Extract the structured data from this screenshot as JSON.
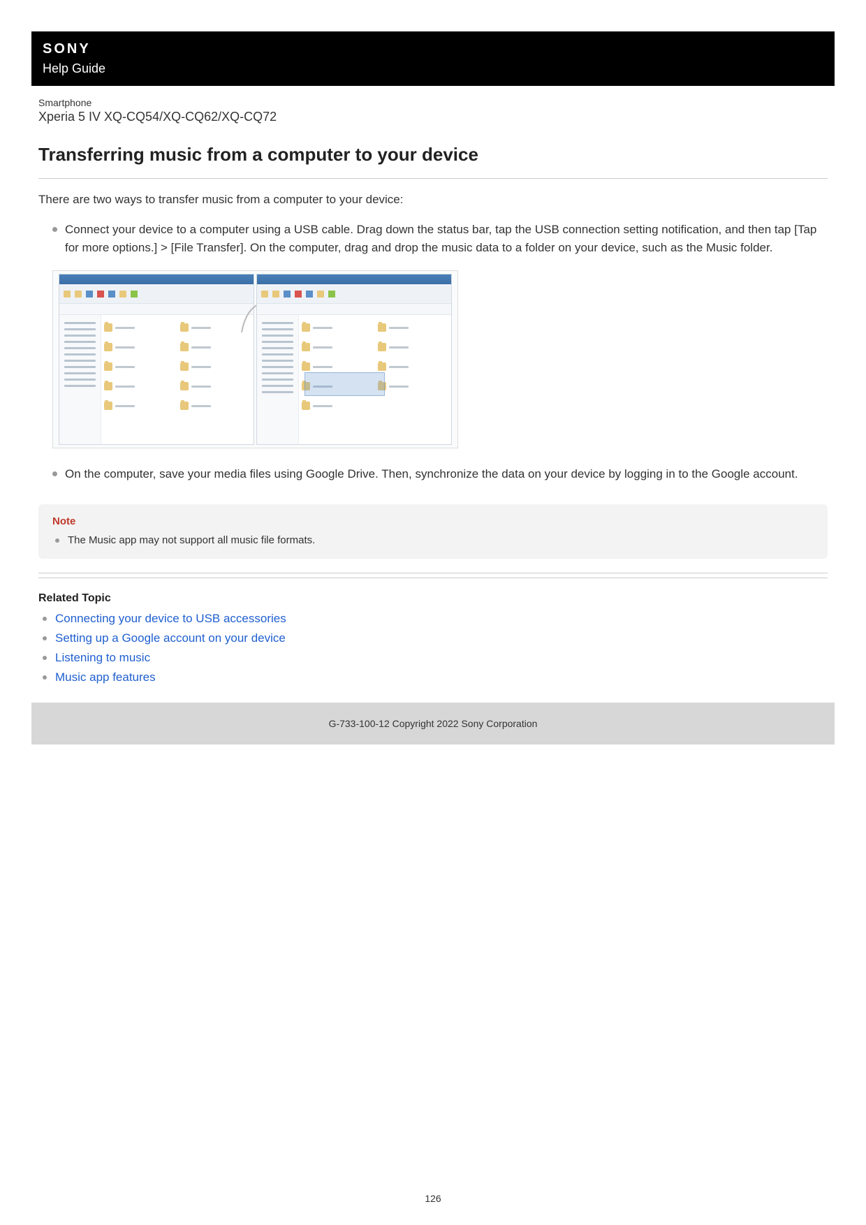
{
  "header": {
    "brand": "SONY",
    "subtitle": "Help Guide"
  },
  "meta": {
    "category": "Smartphone",
    "model": "Xperia 5 IV XQ-CQ54/XQ-CQ62/XQ-CQ72"
  },
  "title": "Transferring music from a computer to your device",
  "intro": "There are two ways to transfer music from a computer to your device:",
  "steps": {
    "item1": "Connect your device to a computer using a USB cable. Drag down the status bar, tap the USB connection setting notification, and then tap [Tap for more options.] > [File Transfer]. On the computer, drag and drop the music data to a folder on your device, such as the Music folder.",
    "item2": "On the computer, save your media files using Google Drive. Then, synchronize the data on your device by logging in to the Google account."
  },
  "note": {
    "label": "Note",
    "item1": "The Music app may not support all music file formats."
  },
  "related": {
    "heading": "Related Topic",
    "link1": "Connecting your device to USB accessories",
    "link2": "Setting up a Google account on your device",
    "link3": "Listening to music",
    "link4": "Music app features"
  },
  "footer": "G-733-100-12 Copyright 2022 Sony Corporation",
  "page_number": "126"
}
